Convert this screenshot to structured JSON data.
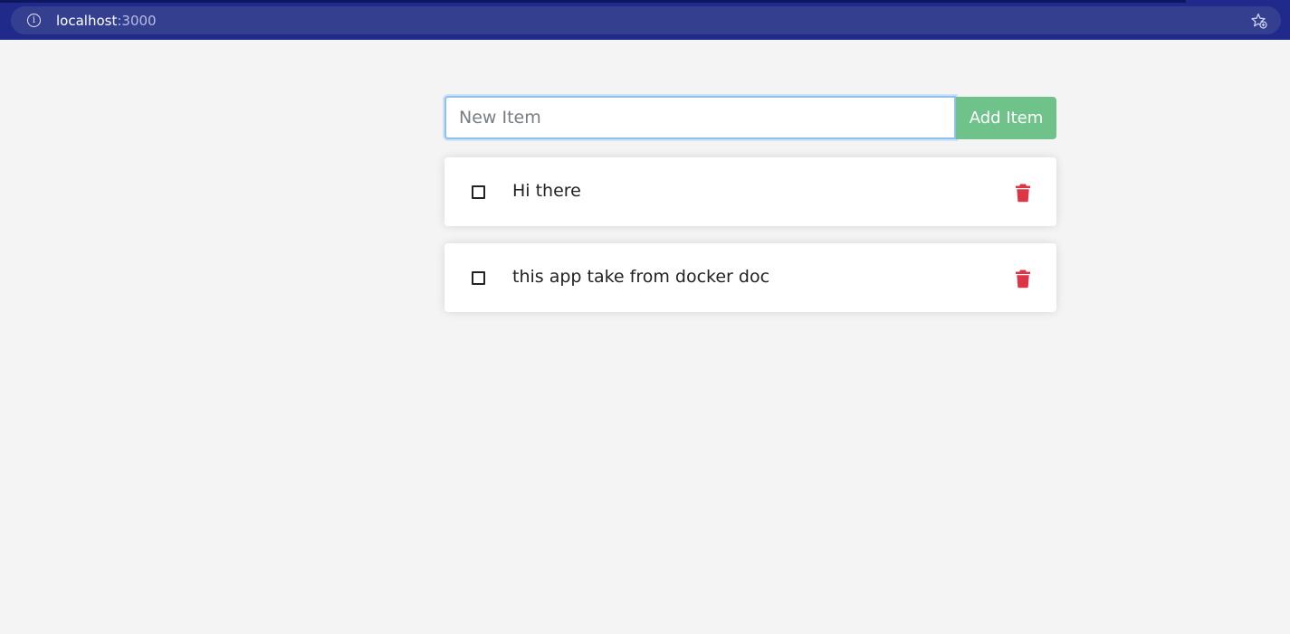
{
  "browser": {
    "url_host": "localhost",
    "url_port": ":3000"
  },
  "form": {
    "input_value": "",
    "input_placeholder": "New Item",
    "add_label": "Add Item"
  },
  "items": [
    {
      "text": "Hi there",
      "completed": false
    },
    {
      "text": "this app take from docker doc",
      "completed": false
    }
  ],
  "colors": {
    "accent_green": "#6fc38a",
    "delete_red": "#dc3545",
    "browser_bar": "#1f2a8a"
  },
  "icons": {
    "address_info": "info-icon",
    "bookmark": "star-icon",
    "item_delete": "trash-icon",
    "item_toggle": "checkbox-icon"
  }
}
